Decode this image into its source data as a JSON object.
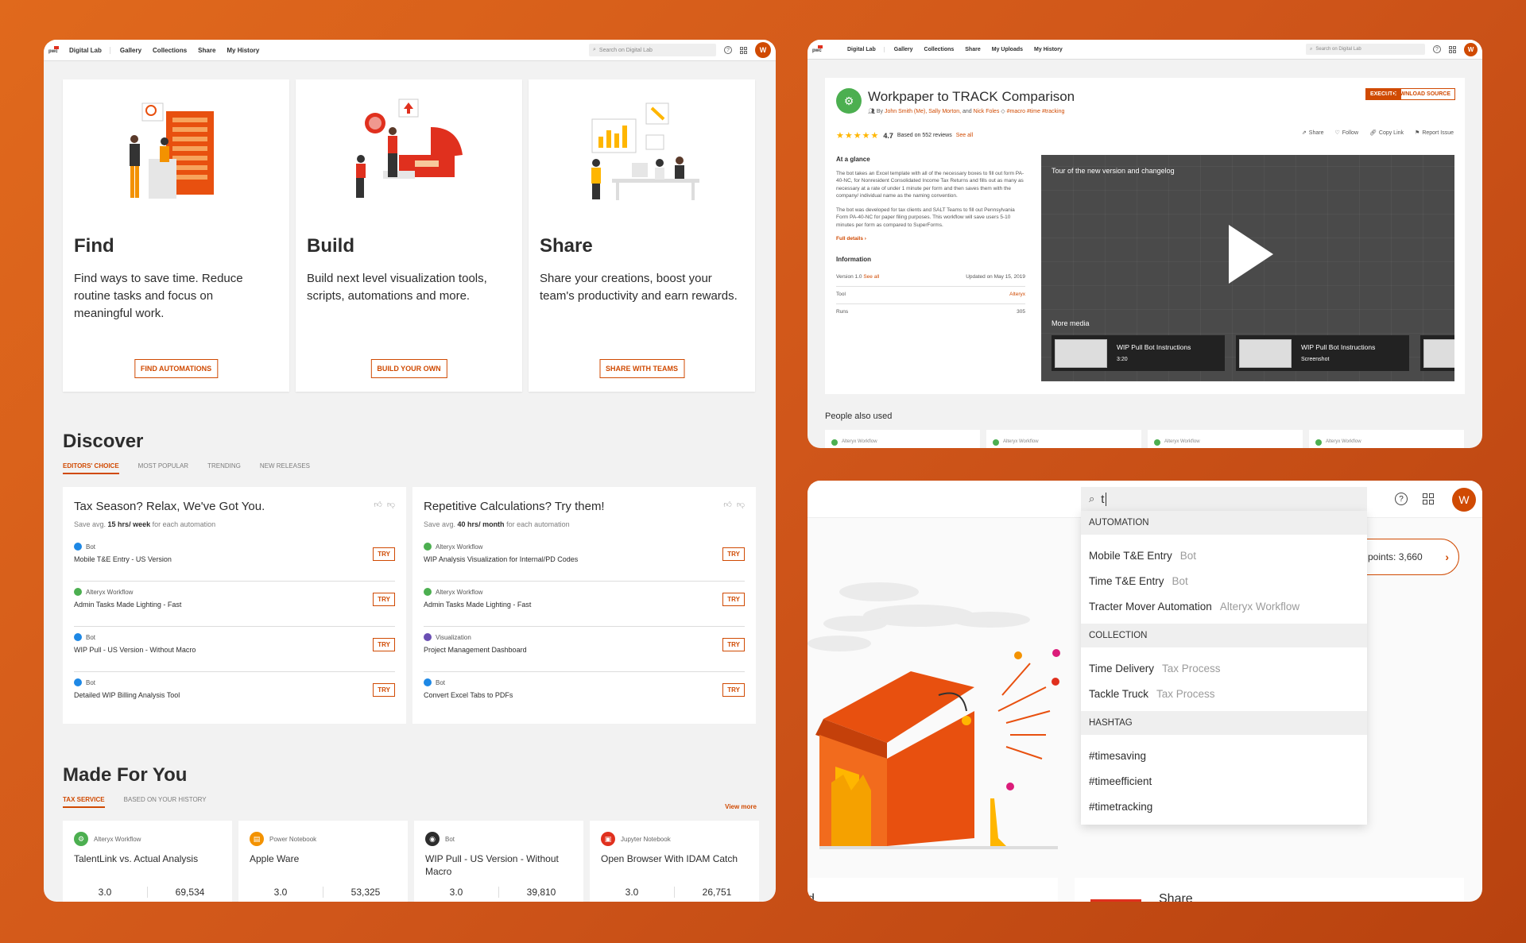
{
  "panel1": {
    "nav": {
      "logo": "pwc",
      "app": "Digital Lab",
      "links": [
        "Gallery",
        "Collections",
        "Share",
        "My History"
      ],
      "search_placeholder": "Search on Digital Lab",
      "avatar": "W"
    },
    "hero": [
      {
        "title": "Find",
        "desc": "Find ways to save time. Reduce routine tasks and focus on meaningful work.",
        "button": "FIND AUTOMATIONS",
        "illus": "find-illustration"
      },
      {
        "title": "Build",
        "desc": "Build next level visualization tools, scripts, automations and more.",
        "button": "BUILD YOUR OWN",
        "illus": "build-illustration"
      },
      {
        "title": "Share",
        "desc": "Share your creations, boost your team's productivity and earn rewards.",
        "button": "SHARE WITH TEAMS",
        "illus": "share-illustration"
      }
    ],
    "discover": {
      "title": "Discover",
      "tabs": [
        "EDITORS' CHOICE",
        "MOST POPULAR",
        "TRENDING",
        "NEW RELEASES"
      ],
      "cards": [
        {
          "title": "Tax Season? Relax, We've Got You.",
          "save_prefix": "Save avg.",
          "save_value": "15 hrs/ week",
          "save_suffix": "for each automation",
          "items": [
            {
              "type": "Bot",
              "name": "Mobile T&E Entry - US Version",
              "color": "#1e88e5",
              "try": "TRY"
            },
            {
              "type": "Alteryx Workflow",
              "name": "Admin Tasks Made Lighting - Fast",
              "color": "#4caf50",
              "try": "TRY"
            },
            {
              "type": "Bot",
              "name": "WIP Pull - US Version - Without Macro",
              "color": "#1e88e5",
              "try": "TRY"
            },
            {
              "type": "Bot",
              "name": "Detailed WIP Billing Analysis Tool",
              "color": "#1e88e5",
              "try": "TRY"
            }
          ]
        },
        {
          "title": "Repetitive Calculations? Try them!",
          "save_prefix": "Save avg.",
          "save_value": "40 hrs/ month",
          "save_suffix": "for each automation",
          "items": [
            {
              "type": "Alteryx Workflow",
              "name": "WIP Analysis Visualization for Internal/PD Codes",
              "color": "#4caf50",
              "try": "TRY"
            },
            {
              "type": "Alteryx Workflow",
              "name": "Admin Tasks Made Lighting - Fast",
              "color": "#4caf50",
              "try": "TRY"
            },
            {
              "type": "Visualization",
              "name": "Project Management Dashboard",
              "color": "#6a4fb3",
              "try": "TRY"
            },
            {
              "type": "Bot",
              "name": "Convert Excel Tabs to PDFs",
              "color": "#1e88e5",
              "try": "TRY"
            }
          ]
        }
      ]
    },
    "made_for_you": {
      "title": "Made For You",
      "tabs": [
        "TAX SERVICE",
        "BASED ON YOUR HISTORY"
      ],
      "view_more": "View more",
      "cards": [
        {
          "type": "Alteryx Workflow",
          "name": "TalentLink vs. Actual Analysis",
          "rating": "3.0",
          "count": "69,534",
          "color": "#4caf50"
        },
        {
          "type": "Power Notebook",
          "name": "Apple Ware",
          "rating": "3.0",
          "count": "53,325",
          "color": "#f39200"
        },
        {
          "type": "Bot",
          "name": "WIP Pull - US Version - Without Macro",
          "rating": "3.0",
          "count": "39,810",
          "color": "#2d2d2d"
        },
        {
          "type": "Jupyter Notebook",
          "name": "Open Browser With IDAM Catch",
          "rating": "3.0",
          "count": "26,751",
          "color": "#e0301e"
        }
      ]
    }
  },
  "panel2": {
    "nav": {
      "logo": "pwc",
      "app": "Digital Lab",
      "links": [
        "Gallery",
        "Collections",
        "Share",
        "My Uploads",
        "My History"
      ],
      "search_placeholder": "Search on Digital Lab",
      "avatar": "W"
    },
    "title": "Workpaper to TRACK Comparison",
    "by": "By",
    "authors": "John Smith (Me), Sally Morton,",
    "and": "and",
    "author_last": "Nick Foles",
    "tags": "#macro #time #tracking",
    "execute": "EXECUTE",
    "download": "DOWNLOAD SOURCE",
    "rating": "4.7",
    "reviews": "Based on 552 reviews",
    "see_all": "See all",
    "actions": [
      "Share",
      "Follow",
      "Copy Link",
      "Report Issue"
    ],
    "glance_title": "At a glance",
    "glance_p1": "The bot takes an Excel template with all of the necessary boxes to fill out form PA-40-NC, for Nonresident Consolidated Income Tax Returns and fills out as many as necessary at a rate of under 1 minute per form and then saves them with the company/ individual name as the naming convention.",
    "glance_p2": "The bot was developed for tax clients and SALT Teams to fill out Pennsylvania Form PA-40-NC for paper filing purposes. This workflow will save users 5-10 minutes per form as compared to SuperForms.",
    "full_details": "Full details ›",
    "info_title": "Information",
    "version": "Version 1.0",
    "version_see": "See all",
    "updated": "Updated on May 15, 2019",
    "tool_label": "Tool",
    "tool_value": "Alteryx",
    "runs_label": "Runs",
    "runs_value": "305",
    "video_title": "Tour of the new version and changelog",
    "more_media": "More media",
    "media": [
      {
        "title": "WIP Pull Bot Instructions",
        "sub": "3:20"
      },
      {
        "title": "WIP Pull Bot Instructions",
        "sub": "Screenshot"
      }
    ],
    "people_also": "People also used",
    "people_types": [
      "Alteryx Workflow",
      "Alteryx Workflow",
      "Alteryx Workflow",
      "Alteryx Workflow"
    ]
  },
  "panel3": {
    "query": "t",
    "avatar": "W",
    "points": "points: 3,660",
    "groups": [
      {
        "header": "AUTOMATION",
        "items": [
          {
            "name": "Mobile T&E Entry",
            "sub": "Bot"
          },
          {
            "name": "Time T&E Entry",
            "sub": "Bot"
          },
          {
            "name": "Tracter Mover Automation",
            "sub": "Alteryx Workflow"
          }
        ]
      },
      {
        "header": "COLLECTION",
        "items": [
          {
            "name": "Time Delivery",
            "sub": "Tax Process"
          },
          {
            "name": "Tackle Truck",
            "sub": "Tax Process"
          }
        ]
      },
      {
        "header": "HASHTAG",
        "items": [
          {
            "name": "#timesaving",
            "sub": ""
          },
          {
            "name": "#timeefficient",
            "sub": ""
          },
          {
            "name": "#timetracking",
            "sub": ""
          }
        ]
      }
    ],
    "bottom_left": "d",
    "bottom_right": "Share"
  }
}
